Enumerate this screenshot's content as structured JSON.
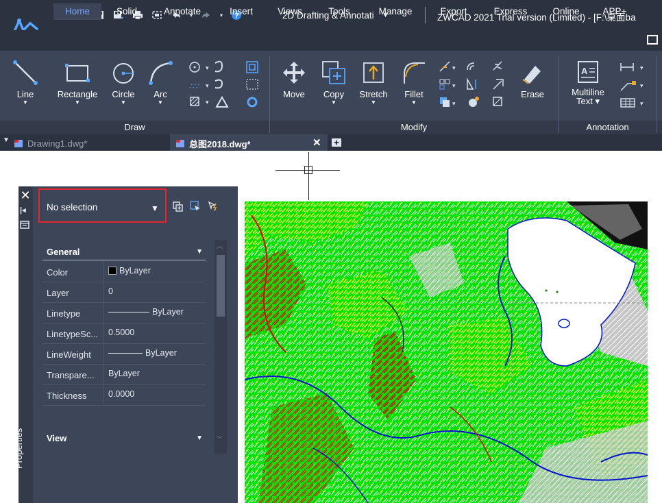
{
  "app": {
    "workspace": "2D Drafting & Annotati",
    "title": "ZWCAD 2021 Trial version (Limited) - [F:\\桌面ba"
  },
  "quick_access": {
    "icons": [
      "new-icon",
      "open-icon",
      "save-icon",
      "save-as-icon",
      "print-icon",
      "zoom-extents-icon",
      "undo-icon",
      "redo-icon",
      "help-icon"
    ]
  },
  "ribbon_tabs": [
    "Home",
    "Solid",
    "Annotate",
    "Insert",
    "Views",
    "Tools",
    "Manage",
    "Export",
    "Express",
    "Online",
    "APP+"
  ],
  "ribbon": {
    "draw": {
      "group_label": "Draw",
      "buttons": [
        "Line",
        "Rectangle",
        "Circle",
        "Arc"
      ]
    },
    "modify": {
      "group_label": "Modify",
      "buttons": [
        "Move",
        "Copy",
        "Stretch",
        "Fillet",
        "Erase"
      ]
    },
    "annotation": {
      "group_label": "Annotation",
      "multiline_line1": "Multiline",
      "multiline_line2": "Text"
    }
  },
  "doc_tabs": [
    {
      "label": "Drawing1.dwg*",
      "active": false
    },
    {
      "label": "总图2018.dwg*",
      "active": true
    }
  ],
  "properties": {
    "vertical_title": "Properties",
    "selection": "No selection",
    "sections": {
      "general": "General",
      "view": "View"
    },
    "rows": [
      {
        "key": "Color",
        "value": "ByLayer"
      },
      {
        "key": "Layer",
        "value": "0"
      },
      {
        "key": "Linetype",
        "value": "ByLayer"
      },
      {
        "key": "LinetypeSc...",
        "value": "0.5000"
      },
      {
        "key": "LineWeight",
        "value": "ByLayer"
      },
      {
        "key": "Transpare...",
        "value": "ByLayer"
      },
      {
        "key": "Thickness",
        "value": "0.0000"
      }
    ]
  },
  "colors": {
    "accent_tab": "#7aa6ff",
    "selection_highlight": "#e3262b",
    "map_green": "#00e400",
    "map_red": "#e00000",
    "map_yellow": "#ffff00",
    "map_blue": "#0014c8"
  }
}
